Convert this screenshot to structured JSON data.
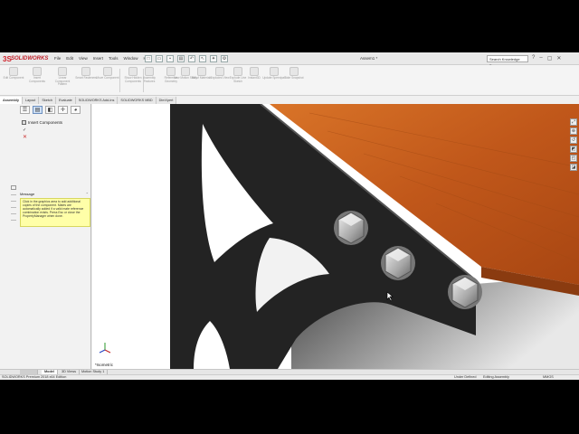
{
  "app": {
    "brand_ds": "3S",
    "brand_name": "SOLIDWORKS",
    "document_title": "Assem1 *"
  },
  "menu": [
    "File",
    "Edit",
    "View",
    "Insert",
    "Tools",
    "Window",
    "Help"
  ],
  "search": {
    "placeholder": "Search Knowledge Base"
  },
  "window_controls": [
    "?",
    "–",
    "▢",
    "✕"
  ],
  "commands": [
    {
      "label": "Edit Component"
    },
    {
      "label": "Insert Components"
    },
    {
      "label": "Linear Component Pattern"
    },
    {
      "label": "Smart Fasteners"
    },
    {
      "label": "Move Component"
    },
    {
      "label": "Show Hidden Components"
    },
    {
      "label": "Assembly Features"
    },
    {
      "label": "Reference Geometry"
    },
    {
      "label": "New Motion Study"
    },
    {
      "label": "Bill of Materials"
    },
    {
      "label": "Exploded View"
    },
    {
      "label": "Explode Line Sketch"
    },
    {
      "label": "Instant3D"
    },
    {
      "label": "Update Speedpak"
    },
    {
      "label": "Take Snapshot"
    }
  ],
  "tabs": [
    "Assembly",
    "Layout",
    "Sketch",
    "Evaluate",
    "SOLIDWORKS Add-Ins",
    "SOLIDWORKS MBD",
    "DimXpert"
  ],
  "property_manager": {
    "title": "Insert Components",
    "ok_symbol": "✓",
    "close_symbol": "✕",
    "message_header": "Message",
    "collapse_symbol": "⌃",
    "message_text": "Click in the graphics area to add additional copies of the component. Mates are automatically added if a valid mate reference combination exists. Press Esc or close the PropertyManager when done."
  },
  "viewport": {
    "view_label": "*Isometric"
  },
  "bottom_tabs": [
    "Model",
    "3D Views",
    "Motion Study 1"
  ],
  "status": {
    "edition": "SOLIDWORKS Premium 2018 x64 Edition",
    "definition": "Under Defined",
    "mode": "Editing Assembly",
    "units": "MMGS"
  },
  "colors": {
    "wood": "#c8621f",
    "steel": "#2a2a2a",
    "bolt": "#b8b8b8"
  }
}
